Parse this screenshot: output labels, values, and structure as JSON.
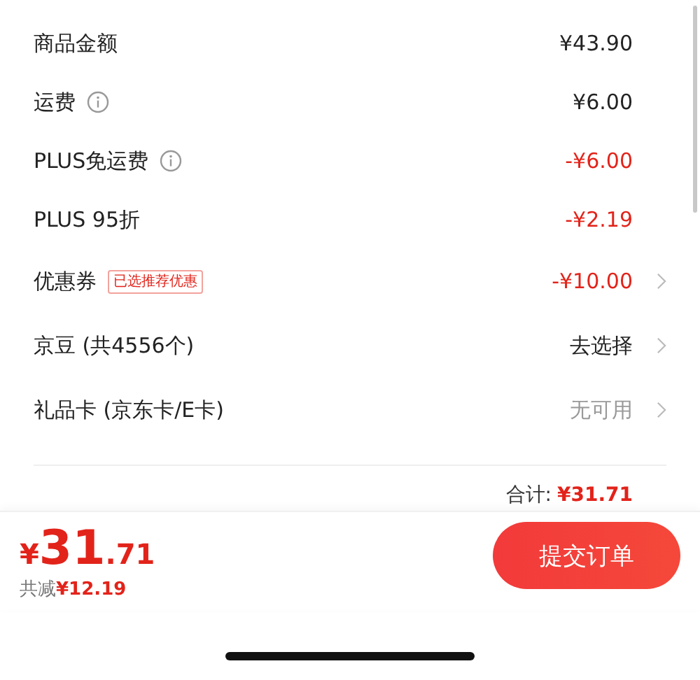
{
  "rows": [
    {
      "label": "商品金额",
      "info": false,
      "value": "¥43.90",
      "color": "#222222",
      "chevron": false
    },
    {
      "label": "运费",
      "info": true,
      "value": "¥6.00",
      "color": "#222222",
      "chevron": false
    },
    {
      "label": "PLUS免运费",
      "info": true,
      "value": "-¥6.00",
      "color": "#e2231a",
      "chevron": false
    },
    {
      "label": "PLUS 95折",
      "info": false,
      "value": "-¥2.19",
      "color": "#e2231a",
      "chevron": false
    },
    {
      "label": "优惠券",
      "info": false,
      "tag": "已选推荐优惠",
      "value": "-¥10.00",
      "color": "#e2231a",
      "chevron": true
    },
    {
      "label": "京豆 (共4556个)",
      "info": false,
      "value": "去选择",
      "color": "#222222",
      "chevron": true
    },
    {
      "label": "礼品卡 (京东卡/E卡)",
      "info": false,
      "value": "无可用",
      "color": "#999999",
      "chevron": true
    }
  ],
  "total": {
    "label": "合计:",
    "value": "¥31.71"
  },
  "footer": {
    "currency": "¥",
    "integer": "31",
    "decimal": ".71",
    "saved_label": "共减",
    "saved_value": "¥12.19",
    "submit": "提交订单"
  }
}
